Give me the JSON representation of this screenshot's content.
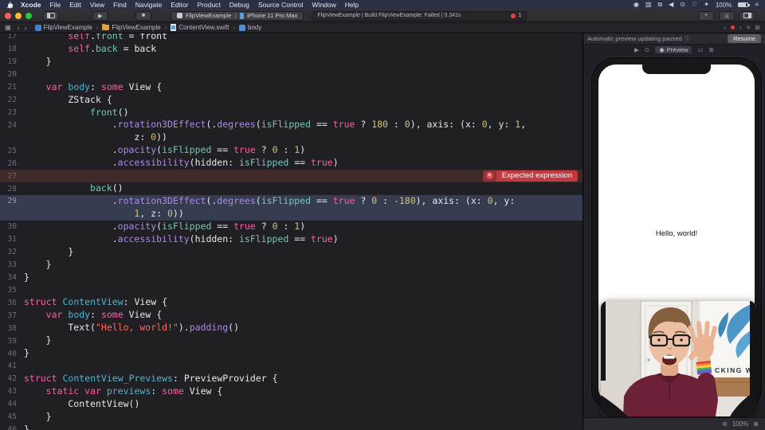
{
  "menu_bar": {
    "items": [
      "Xcode",
      "File",
      "Edit",
      "View",
      "Find",
      "Navigate",
      "Editor",
      "Product",
      "Debug",
      "Source Control",
      "Window",
      "Help"
    ],
    "status_icons": [
      {
        "name": "record-status-icon",
        "glyph": "◉"
      },
      {
        "name": "video-capture-icon",
        "glyph": "▥"
      },
      {
        "name": "screen-mirroring-icon",
        "glyph": "⧉"
      },
      {
        "name": "volume-icon",
        "glyph": "◀"
      },
      {
        "name": "spotlight-search-icon",
        "glyph": "⊙"
      },
      {
        "name": "control-center-icon",
        "glyph": "♡"
      },
      {
        "name": "accessory-icon",
        "glyph": "✦"
      }
    ],
    "battery_percent": "100%"
  },
  "toolbar": {
    "scheme": {
      "project": "FlipViewExample",
      "separator": "⟩",
      "device": "iPhone 11 Pro Max"
    },
    "status_text": "FlipViewExample | Build FlipViewExample: Failed | 0.341s",
    "error_count": "1",
    "plus_label": "+",
    "library_label": "▣"
  },
  "jump_bar": {
    "breadcrumbs": [
      {
        "icon": "project",
        "label": "FlipViewExample"
      },
      {
        "icon": "folder",
        "label": "FlipViewExample"
      },
      {
        "icon": "swift-file",
        "label": "ContentView.swift"
      },
      {
        "icon": "scope",
        "label": "body"
      }
    ],
    "separator": "›",
    "back": "‹",
    "forward": "›",
    "minimap_glyph": "≡",
    "add_editor_glyph": "⊞",
    "grid_glyph": "▦"
  },
  "editor": {
    "lines": [
      {
        "n": "17",
        "ind": 8,
        "seg": [
          [
            "self",
            "k"
          ],
          [
            ".",
            "p"
          ],
          [
            "front",
            "t"
          ],
          [
            " = front",
            "p"
          ]
        ]
      },
      {
        "n": "18",
        "ind": 8,
        "seg": [
          [
            "self",
            "k"
          ],
          [
            ".",
            "p"
          ],
          [
            "back",
            "t"
          ],
          [
            " = back",
            "p"
          ]
        ]
      },
      {
        "n": "19",
        "ind": 4,
        "seg": [
          [
            "}",
            "p"
          ]
        ]
      },
      {
        "n": "20",
        "ind": 0,
        "seg": []
      },
      {
        "n": "21",
        "ind": 4,
        "seg": [
          [
            "var",
            "k"
          ],
          [
            " ",
            "p"
          ],
          [
            "body",
            "c"
          ],
          [
            ": ",
            "p"
          ],
          [
            "some",
            "k"
          ],
          [
            " View {",
            "p"
          ]
        ]
      },
      {
        "n": "22",
        "ind": 8,
        "seg": [
          [
            "ZStack {",
            "p"
          ]
        ]
      },
      {
        "n": "23",
        "ind": 12,
        "seg": [
          [
            "front",
            "t"
          ],
          [
            "()",
            "p"
          ]
        ]
      },
      {
        "n": "24",
        "ind": 16,
        "seg": [
          [
            ".",
            "p"
          ],
          [
            "rotation3DEffect",
            "f"
          ],
          [
            "(.",
            "p"
          ],
          [
            "degrees",
            "f"
          ],
          [
            "(",
            "p"
          ],
          [
            "isFlipped",
            "t"
          ],
          [
            " == ",
            "p"
          ],
          [
            "true",
            "k"
          ],
          [
            " ? ",
            "p"
          ],
          [
            "180",
            "n"
          ],
          [
            " : ",
            "p"
          ],
          [
            "0",
            "n"
          ],
          [
            "), axis: (x: ",
            "p"
          ],
          [
            "0",
            "n"
          ],
          [
            ", y: ",
            "p"
          ],
          [
            "1",
            "n"
          ],
          [
            ",",
            "p"
          ]
        ]
      },
      {
        "n": "",
        "ind": 20,
        "seg": [
          [
            "z: ",
            "p"
          ],
          [
            "0",
            "n"
          ],
          [
            "))",
            "p"
          ]
        ]
      },
      {
        "n": "25",
        "ind": 16,
        "seg": [
          [
            ".",
            "p"
          ],
          [
            "opacity",
            "f"
          ],
          [
            "(",
            "p"
          ],
          [
            "isFlipped",
            "t"
          ],
          [
            " == ",
            "p"
          ],
          [
            "true",
            "k"
          ],
          [
            " ? ",
            "p"
          ],
          [
            "0",
            "n"
          ],
          [
            " : ",
            "p"
          ],
          [
            "1",
            "n"
          ],
          [
            ")",
            "p"
          ]
        ]
      },
      {
        "n": "26",
        "ind": 16,
        "seg": [
          [
            ".",
            "p"
          ],
          [
            "accessibility",
            "f"
          ],
          [
            "(hidden: ",
            "p"
          ],
          [
            "isFlipped",
            "t"
          ],
          [
            " == ",
            "p"
          ],
          [
            "true",
            "k"
          ],
          [
            ")",
            "p"
          ]
        ]
      },
      {
        "n": "27",
        "ind": 0,
        "seg": [],
        "state": "error",
        "badge": "Expected expression"
      },
      {
        "n": "28",
        "ind": 12,
        "seg": [
          [
            "back",
            "t"
          ],
          [
            "()",
            "p"
          ]
        ]
      },
      {
        "n": "29",
        "ind": 16,
        "state": "sel",
        "seg": [
          [
            ".",
            "p"
          ],
          [
            "rotation3DEffect",
            "f"
          ],
          [
            "(.",
            "p"
          ],
          [
            "degrees",
            "f"
          ],
          [
            "(",
            "p"
          ],
          [
            "isFlipped",
            "t"
          ],
          [
            " == ",
            "p"
          ],
          [
            "true",
            "k"
          ],
          [
            " ? ",
            "p"
          ],
          [
            "0",
            "n"
          ],
          [
            " : ",
            "p"
          ],
          [
            "-180",
            "n"
          ],
          [
            "), axis: (x: ",
            "p"
          ],
          [
            "0",
            "n"
          ],
          [
            ", y:",
            "p"
          ]
        ]
      },
      {
        "n": "",
        "ind": 20,
        "state": "sel",
        "seg": [
          [
            "1",
            "n"
          ],
          [
            ", z: ",
            "p"
          ],
          [
            "0",
            "n"
          ],
          [
            "))",
            "p"
          ]
        ]
      },
      {
        "n": "30",
        "ind": 16,
        "seg": [
          [
            ".",
            "p"
          ],
          [
            "opacity",
            "f"
          ],
          [
            "(",
            "p"
          ],
          [
            "isFlipped",
            "t"
          ],
          [
            " == ",
            "p"
          ],
          [
            "true",
            "k"
          ],
          [
            " ? ",
            "p"
          ],
          [
            "0",
            "n"
          ],
          [
            " : ",
            "p"
          ],
          [
            "1",
            "n"
          ],
          [
            ")",
            "p"
          ]
        ]
      },
      {
        "n": "31",
        "ind": 16,
        "seg": [
          [
            ".",
            "p"
          ],
          [
            "accessibility",
            "f"
          ],
          [
            "(hidden: ",
            "p"
          ],
          [
            "isFlipped",
            "t"
          ],
          [
            " == ",
            "p"
          ],
          [
            "true",
            "k"
          ],
          [
            ")",
            "p"
          ]
        ]
      },
      {
        "n": "32",
        "ind": 8,
        "seg": [
          [
            "}",
            "p"
          ]
        ]
      },
      {
        "n": "33",
        "ind": 4,
        "seg": [
          [
            "}",
            "p"
          ]
        ]
      },
      {
        "n": "34",
        "ind": 0,
        "seg": [
          [
            "}",
            "p"
          ]
        ]
      },
      {
        "n": "35",
        "ind": 0,
        "seg": []
      },
      {
        "n": "36",
        "ind": 0,
        "seg": [
          [
            "struct",
            "k"
          ],
          [
            " ",
            "p"
          ],
          [
            "ContentView",
            "c"
          ],
          [
            ": View {",
            "p"
          ]
        ]
      },
      {
        "n": "37",
        "ind": 4,
        "seg": [
          [
            "var",
            "k"
          ],
          [
            " ",
            "p"
          ],
          [
            "body",
            "c"
          ],
          [
            ": ",
            "p"
          ],
          [
            "some",
            "k"
          ],
          [
            " View {",
            "p"
          ]
        ]
      },
      {
        "n": "38",
        "ind": 8,
        "seg": [
          [
            "Text(",
            "p"
          ],
          [
            "\"Hello, world!\"",
            "s"
          ],
          [
            ").",
            "p"
          ],
          [
            "padding",
            "f"
          ],
          [
            "()",
            "p"
          ]
        ]
      },
      {
        "n": "39",
        "ind": 4,
        "seg": [
          [
            "}",
            "p"
          ]
        ]
      },
      {
        "n": "40",
        "ind": 0,
        "seg": [
          [
            "}",
            "p"
          ]
        ]
      },
      {
        "n": "41",
        "ind": 0,
        "seg": []
      },
      {
        "n": "42",
        "ind": 0,
        "seg": [
          [
            "struct",
            "k"
          ],
          [
            " ",
            "p"
          ],
          [
            "ContentView_Previews",
            "c"
          ],
          [
            ": PreviewProvider {",
            "p"
          ]
        ]
      },
      {
        "n": "43",
        "ind": 4,
        "seg": [
          [
            "static",
            "k"
          ],
          [
            " ",
            "p"
          ],
          [
            "var",
            "k"
          ],
          [
            " ",
            "p"
          ],
          [
            "previews",
            "c"
          ],
          [
            ": ",
            "p"
          ],
          [
            "some",
            "k"
          ],
          [
            " View {",
            "p"
          ]
        ]
      },
      {
        "n": "44",
        "ind": 8,
        "seg": [
          [
            "ContentView()",
            "p"
          ]
        ]
      },
      {
        "n": "45",
        "ind": 4,
        "seg": [
          [
            "}",
            "p"
          ]
        ]
      },
      {
        "n": "46",
        "ind": 0,
        "seg": [
          [
            "}",
            "p"
          ]
        ]
      }
    ]
  },
  "preview": {
    "banner_text": "Automatic preview updating paused",
    "info_glyph": "ⓘ",
    "resume_label": "Resume",
    "toolbar_segments": [
      {
        "name": "live-preview-icon",
        "glyph": "▶",
        "label": "",
        "active": false
      },
      {
        "name": "pin-preview-icon",
        "glyph": "⊙",
        "label": "",
        "active": false
      },
      {
        "name": "preview-tab",
        "glyph": "◉",
        "label": "Preview",
        "active": true
      },
      {
        "name": "device-preview-icon",
        "glyph": "▭",
        "label": "",
        "active": false
      },
      {
        "name": "inspect-preview-icon",
        "glyph": "⊞",
        "label": "",
        "active": false
      }
    ],
    "device_text": "Hello, world!",
    "zoom_out_glyph": "⊖",
    "zoom_level": "100%",
    "zoom_in_glyph": "⊕"
  },
  "webcam": {
    "banner_text": "CKING W"
  }
}
